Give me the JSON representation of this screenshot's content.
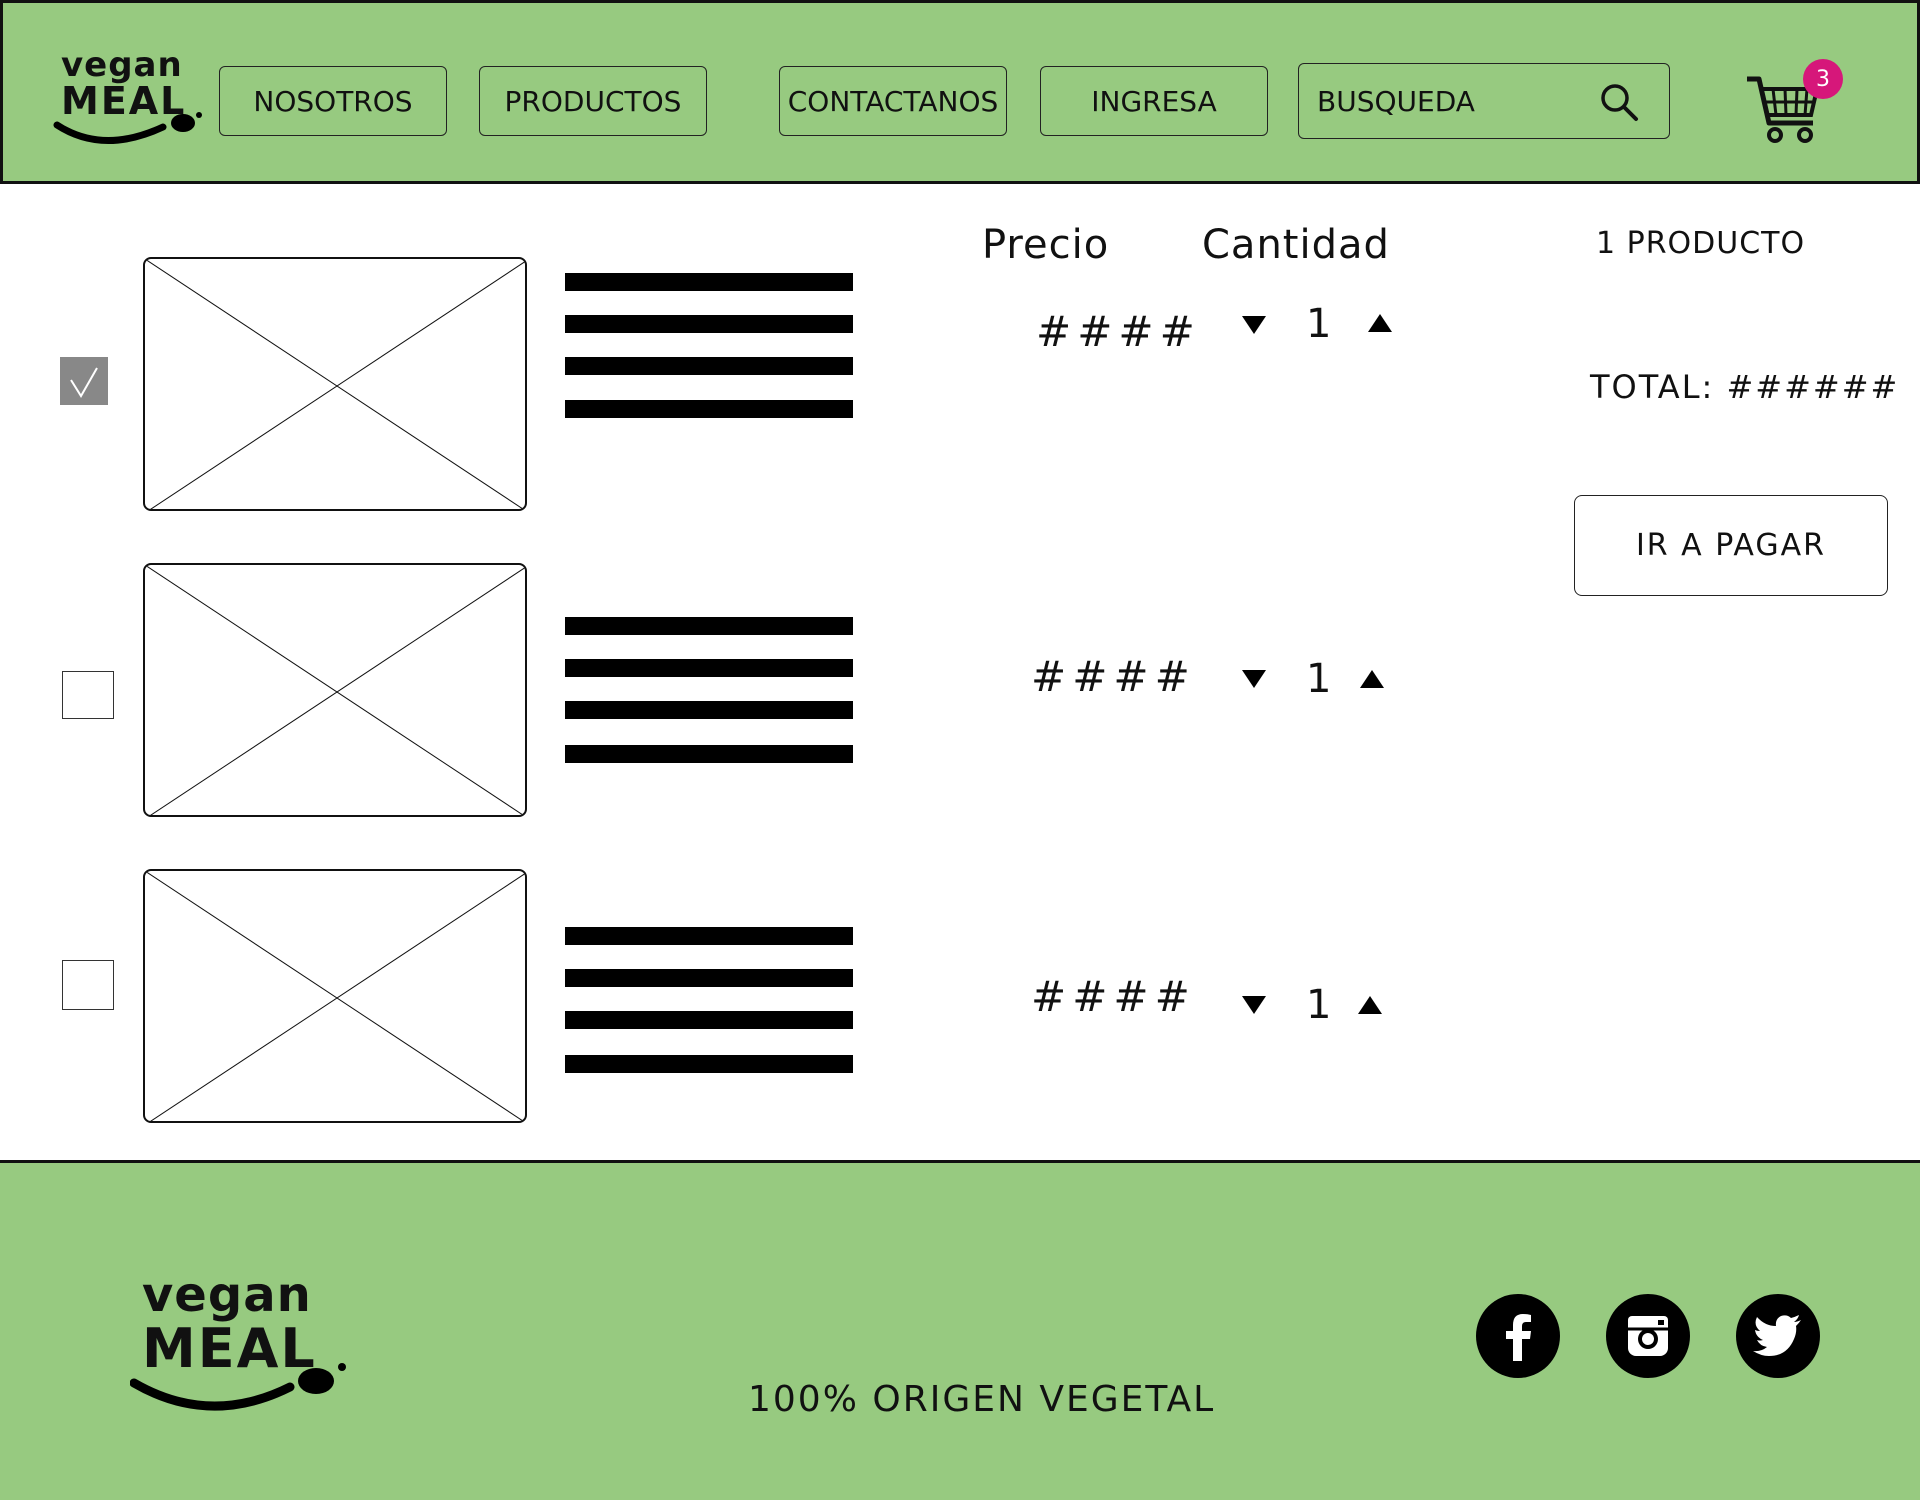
{
  "header": {
    "logo": {
      "line1": "vegan",
      "line2": "MEAL"
    },
    "nav": [
      "NOSOTROS",
      "PRODUCTOS",
      "CONTACTANOS",
      "INGRESA"
    ],
    "search": {
      "placeholder": "BUSQUEDA",
      "icon": "search-icon"
    },
    "cart": {
      "icon": "shopping-cart-icon",
      "badge": "3",
      "badge_color": "#d6177a"
    }
  },
  "cart_table": {
    "headers": {
      "price": "Precio",
      "quantity": "Cantidad"
    },
    "rows": [
      {
        "selected": true,
        "price": "####",
        "quantity": "1"
      },
      {
        "selected": false,
        "price": "####",
        "quantity": "1"
      },
      {
        "selected": false,
        "price": "####",
        "quantity": "1"
      }
    ]
  },
  "summary": {
    "count": "1 PRODUCTO",
    "total": "TOTAL: ######",
    "pay_label": "IR A PAGAR"
  },
  "footer": {
    "logo": {
      "line1": "vegan",
      "line2": "MEAL"
    },
    "tagline": "100% ORIGEN VEGETAL",
    "social": [
      "facebook-icon",
      "instagram-icon",
      "twitter-icon"
    ]
  },
  "colors": {
    "brand_green": "#97ca80",
    "text": "#111111",
    "checked_gray": "#888888"
  }
}
